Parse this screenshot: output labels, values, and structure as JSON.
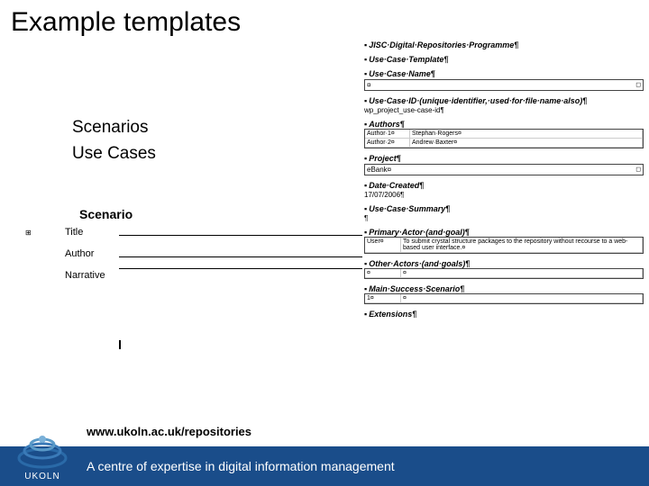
{
  "title": "Example templates",
  "bullets": {
    "line1": "Scenarios",
    "line2": "Use Cases"
  },
  "scenario": {
    "heading": "Scenario",
    "grid_mark": "⊞",
    "row1": "Title",
    "row2": "Author",
    "row3": "Narrative"
  },
  "usecase": {
    "h_programme": "JISC·Digital·Repositories·Programme¶",
    "h_template": "Use·Case·Template¶",
    "h_name": "Use·Case·Name¶",
    "name_val": "¤",
    "h_id": "Use·Case·ID·(unique·identifier,·used·for·file·name·also)¶",
    "id_val": "wp_project_use-case-id¶",
    "h_authors": "Authors¶",
    "auth1_k": "Author·1¤",
    "auth1_v": "Stephan·Rogers¤",
    "auth2_k": "Author·2¤",
    "auth2_v": "Andrew·Baxter¤",
    "h_project": "Project¶",
    "project_val": "eBank¤",
    "h_date": "Date·Created¶",
    "date_val": "17/07/2006¶",
    "h_summary": "Use·Case·Summary¶",
    "summary_val": "¶",
    "h_primary": "Primary·Actor·(and·goal)¶",
    "pa_k": "User¤",
    "pa_v": "To submit crystal structure packages to the repository without recourse to a web-based user interface.¤",
    "h_other": "Other·Actors·(and·goals)¶",
    "other_k": "¤",
    "other_v": "¤",
    "h_main": "Main·Success·Scenario¶",
    "main_k": "1¤",
    "main_v": "¤",
    "h_ext": "Extensions¶",
    "end_square": "◻"
  },
  "footer": {
    "url": "www.ukoln.ac.uk/repositories",
    "subtitle": "A centre of expertise in digital information management",
    "brand": "UKOLN"
  }
}
